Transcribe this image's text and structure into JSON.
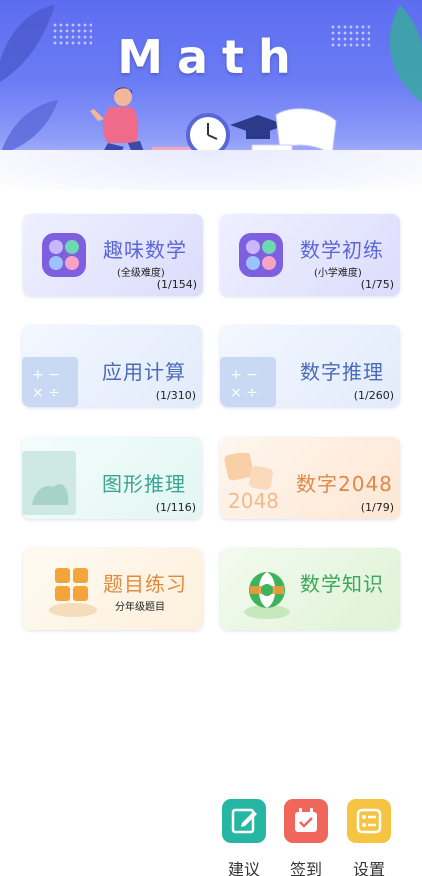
{
  "banner": {
    "title": "Math"
  },
  "cards": [
    {
      "title": "趣味数学",
      "subtitle": "(全级难度)",
      "count": "(1/154)"
    },
    {
      "title": "数学初练",
      "subtitle": "(小学难度)",
      "count": "(1/75)"
    },
    {
      "title": "应用计算",
      "count": "(1/310)"
    },
    {
      "title": "数字推理",
      "count": "(1/260)"
    },
    {
      "title": "图形推理",
      "count": "(1/116)"
    },
    {
      "title": "数字2048",
      "count": "(1/79)",
      "badge": "2048"
    },
    {
      "title": "题目练习",
      "subtitle": "分年级题目"
    },
    {
      "title": "数学知识"
    }
  ],
  "bottom_bar": [
    {
      "label": "建议",
      "icon": "edit-icon",
      "color": "#26b7a4"
    },
    {
      "label": "签到",
      "icon": "calendar-check-icon",
      "color": "#f1665a"
    },
    {
      "label": "设置",
      "icon": "settings-list-icon",
      "color": "#f5c443"
    }
  ]
}
